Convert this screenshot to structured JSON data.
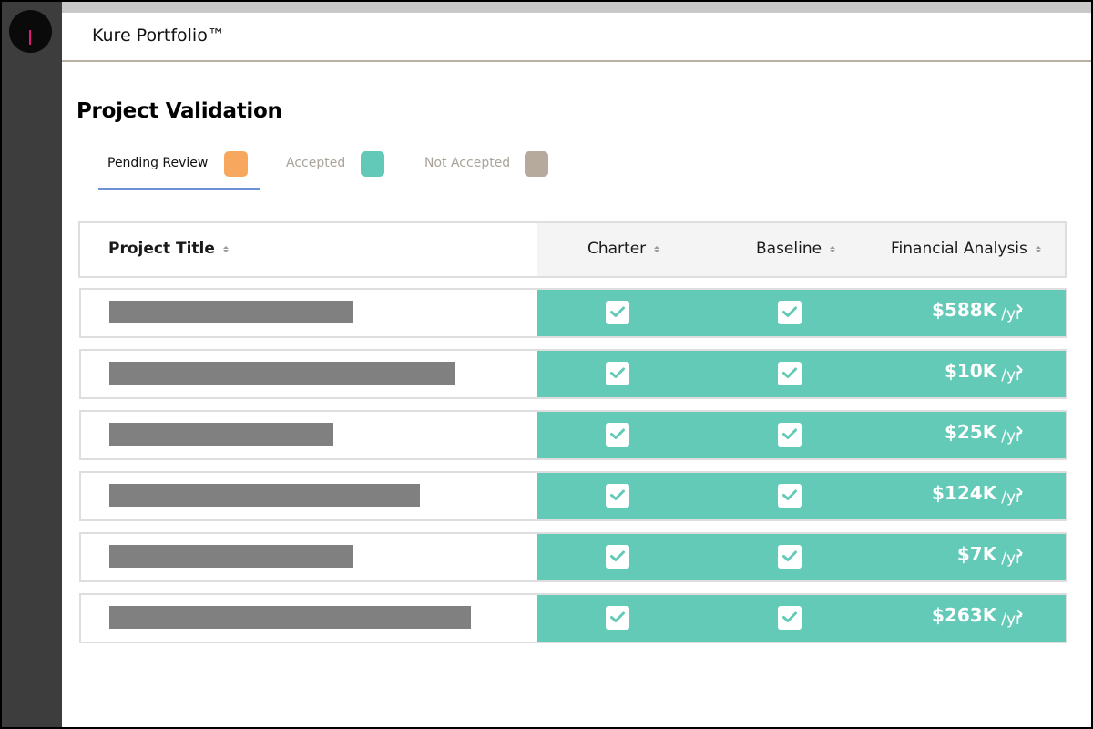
{
  "app": {
    "title": "Kure Portfolio™"
  },
  "page": {
    "title": "Project Validation"
  },
  "tabs": [
    {
      "label": "Pending Review",
      "color": "#f8a85e",
      "active": true
    },
    {
      "label": "Accepted",
      "color": "#62c8b7",
      "active": false
    },
    {
      "label": "Not Accepted",
      "color": "#b5aa9c",
      "active": false
    }
  ],
  "table": {
    "columns": [
      "Project Title",
      "Charter",
      "Baseline",
      "Financial Analysis"
    ],
    "rows": [
      {
        "title_redacted": true,
        "charter": true,
        "baseline": true,
        "amount": "$588K",
        "unit": "/yr"
      },
      {
        "title_redacted": true,
        "charter": true,
        "baseline": true,
        "amount": "$10K",
        "unit": "/yr"
      },
      {
        "title_redacted": true,
        "charter": true,
        "baseline": true,
        "amount": "$25K",
        "unit": "/yr"
      },
      {
        "title_redacted": true,
        "charter": true,
        "baseline": true,
        "amount": "$124K",
        "unit": "/yr"
      },
      {
        "title_redacted": true,
        "charter": true,
        "baseline": true,
        "amount": "$7K",
        "unit": "/yr"
      },
      {
        "title_redacted": true,
        "charter": true,
        "baseline": true,
        "amount": "$263K",
        "unit": "/yr"
      }
    ]
  },
  "colors": {
    "accent": "#64cab8",
    "sidebar": "#3d3d3d",
    "tab_underline": "#6b93d6",
    "redaction": "#808080"
  },
  "icons": {
    "check": "check-icon",
    "chevron": "chevron-right-icon",
    "sort": "sort-icon"
  }
}
